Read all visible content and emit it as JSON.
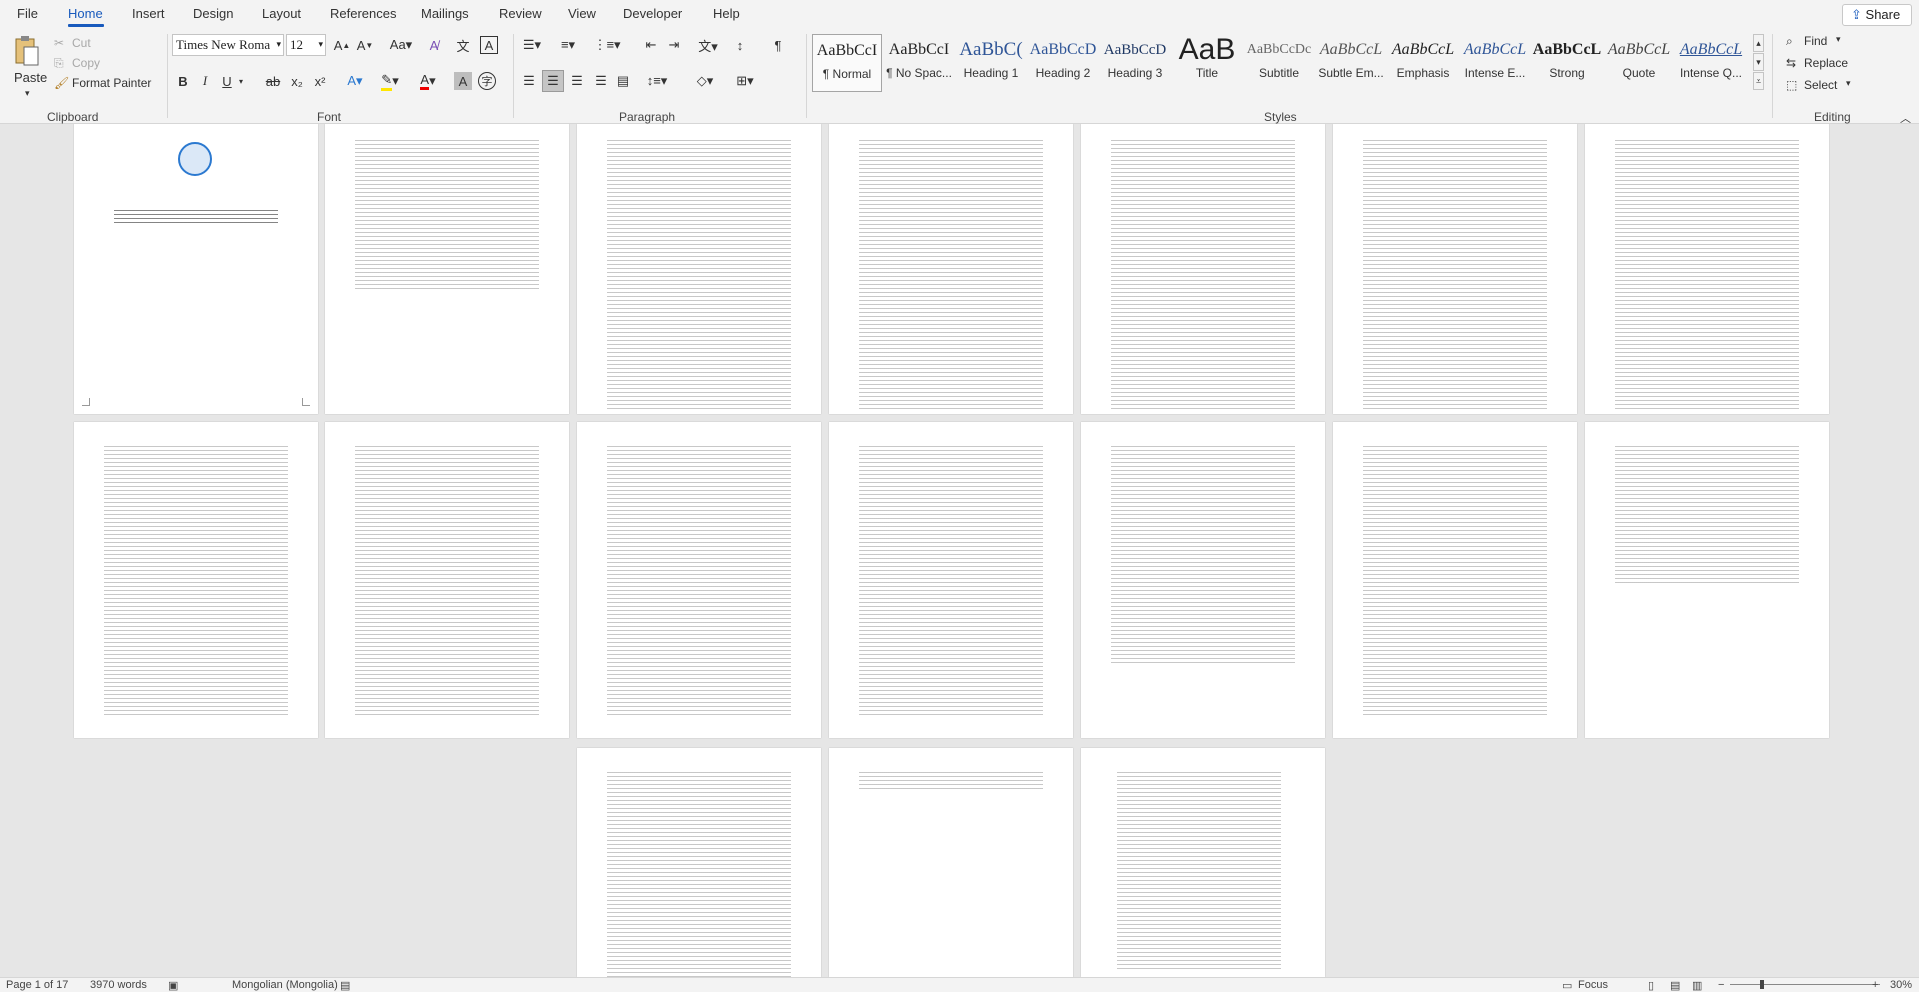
{
  "menu": {
    "tabs": [
      "File",
      "Home",
      "Insert",
      "Design",
      "Layout",
      "References",
      "Mailings",
      "Review",
      "View",
      "Developer",
      "Help"
    ],
    "share": "Share"
  },
  "clipboard": {
    "paste": "Paste",
    "cut": "Cut",
    "copy": "Copy",
    "format_painter": "Format Painter",
    "label": "Clipboard"
  },
  "font": {
    "name": "Times New Roma",
    "size": "12",
    "label": "Font"
  },
  "paragraph": {
    "label": "Paragraph"
  },
  "styles": {
    "label": "Styles",
    "items": [
      {
        "sample": "AaBbCcI",
        "name": "¶ Normal"
      },
      {
        "sample": "AaBbCcI",
        "name": "¶ No Spac..."
      },
      {
        "sample": "AaBbC(",
        "name": "Heading 1"
      },
      {
        "sample": "AaBbCcD",
        "name": "Heading 2"
      },
      {
        "sample": "AaBbCcD",
        "name": "Heading 3"
      },
      {
        "sample": "AaB",
        "name": "Title"
      },
      {
        "sample": "AaBbCcDc",
        "name": "Subtitle"
      },
      {
        "sample": "AaBbCcL",
        "name": "Subtle Em..."
      },
      {
        "sample": "AaBbCcL",
        "name": "Emphasis"
      },
      {
        "sample": "AaBbCcL",
        "name": "Intense E..."
      },
      {
        "sample": "AaBbCcL",
        "name": "Strong"
      },
      {
        "sample": "AaBbCcL",
        "name": "Quote"
      },
      {
        "sample": "AaBbCcL",
        "name": "Intense Q..."
      }
    ]
  },
  "editing": {
    "find": "Find",
    "replace": "Replace",
    "select": "Select",
    "label": "Editing"
  },
  "status": {
    "page": "Page 1 of 17",
    "words": "3970 words",
    "language": "Mongolian (Mongolia)",
    "focus": "Focus",
    "zoom": "30%"
  },
  "colors": {
    "accent": "#185abd",
    "ribbon_bg": "#f3f3f3",
    "doc_bg": "#e6e6e6"
  }
}
